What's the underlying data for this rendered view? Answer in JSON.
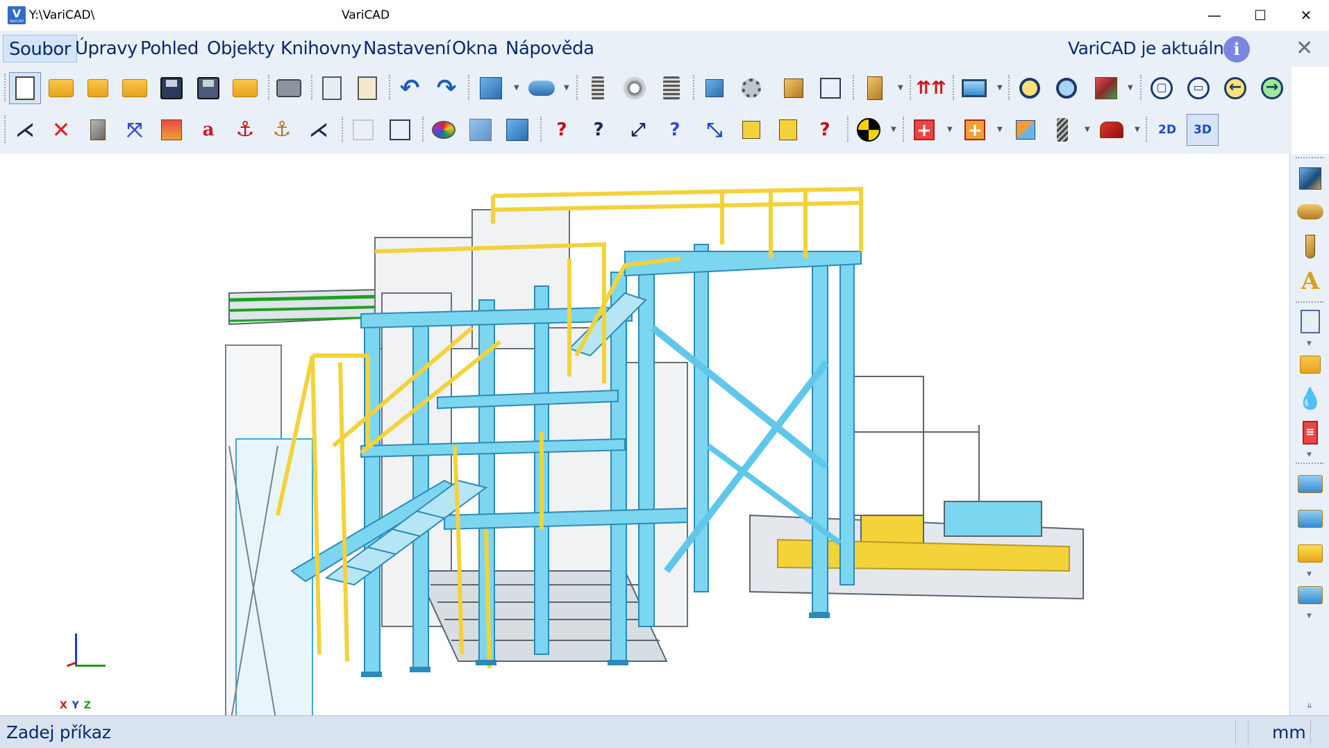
{
  "window": {
    "path": "Y:\\VariCAD\\",
    "title": "VariCAD",
    "logo_letter": "V",
    "logo_subtext": "VariCAD"
  },
  "menu": {
    "items": [
      "Soubor",
      "Úpravy",
      "Pohled",
      "Objekty",
      "Knihovny",
      "Nastavení",
      "Okna",
      "Nápověda"
    ],
    "active": "Soubor",
    "update_status": "VariCAD je aktuální"
  },
  "toolbar": {
    "btn_2d": "2D",
    "btn_3d": "3D",
    "text_tool_glyph": "a"
  },
  "axes": {
    "labels": [
      "X",
      "Y",
      "Z"
    ]
  },
  "status": {
    "command_prompt": "Zadej příkaz",
    "units": "mm"
  },
  "colors": {
    "frame_cyan": "#7dd6f0",
    "railing_yellow": "#f3d23a",
    "conveyor_gray": "#b9c0c8",
    "accent_blue": "#0a2a6a"
  }
}
